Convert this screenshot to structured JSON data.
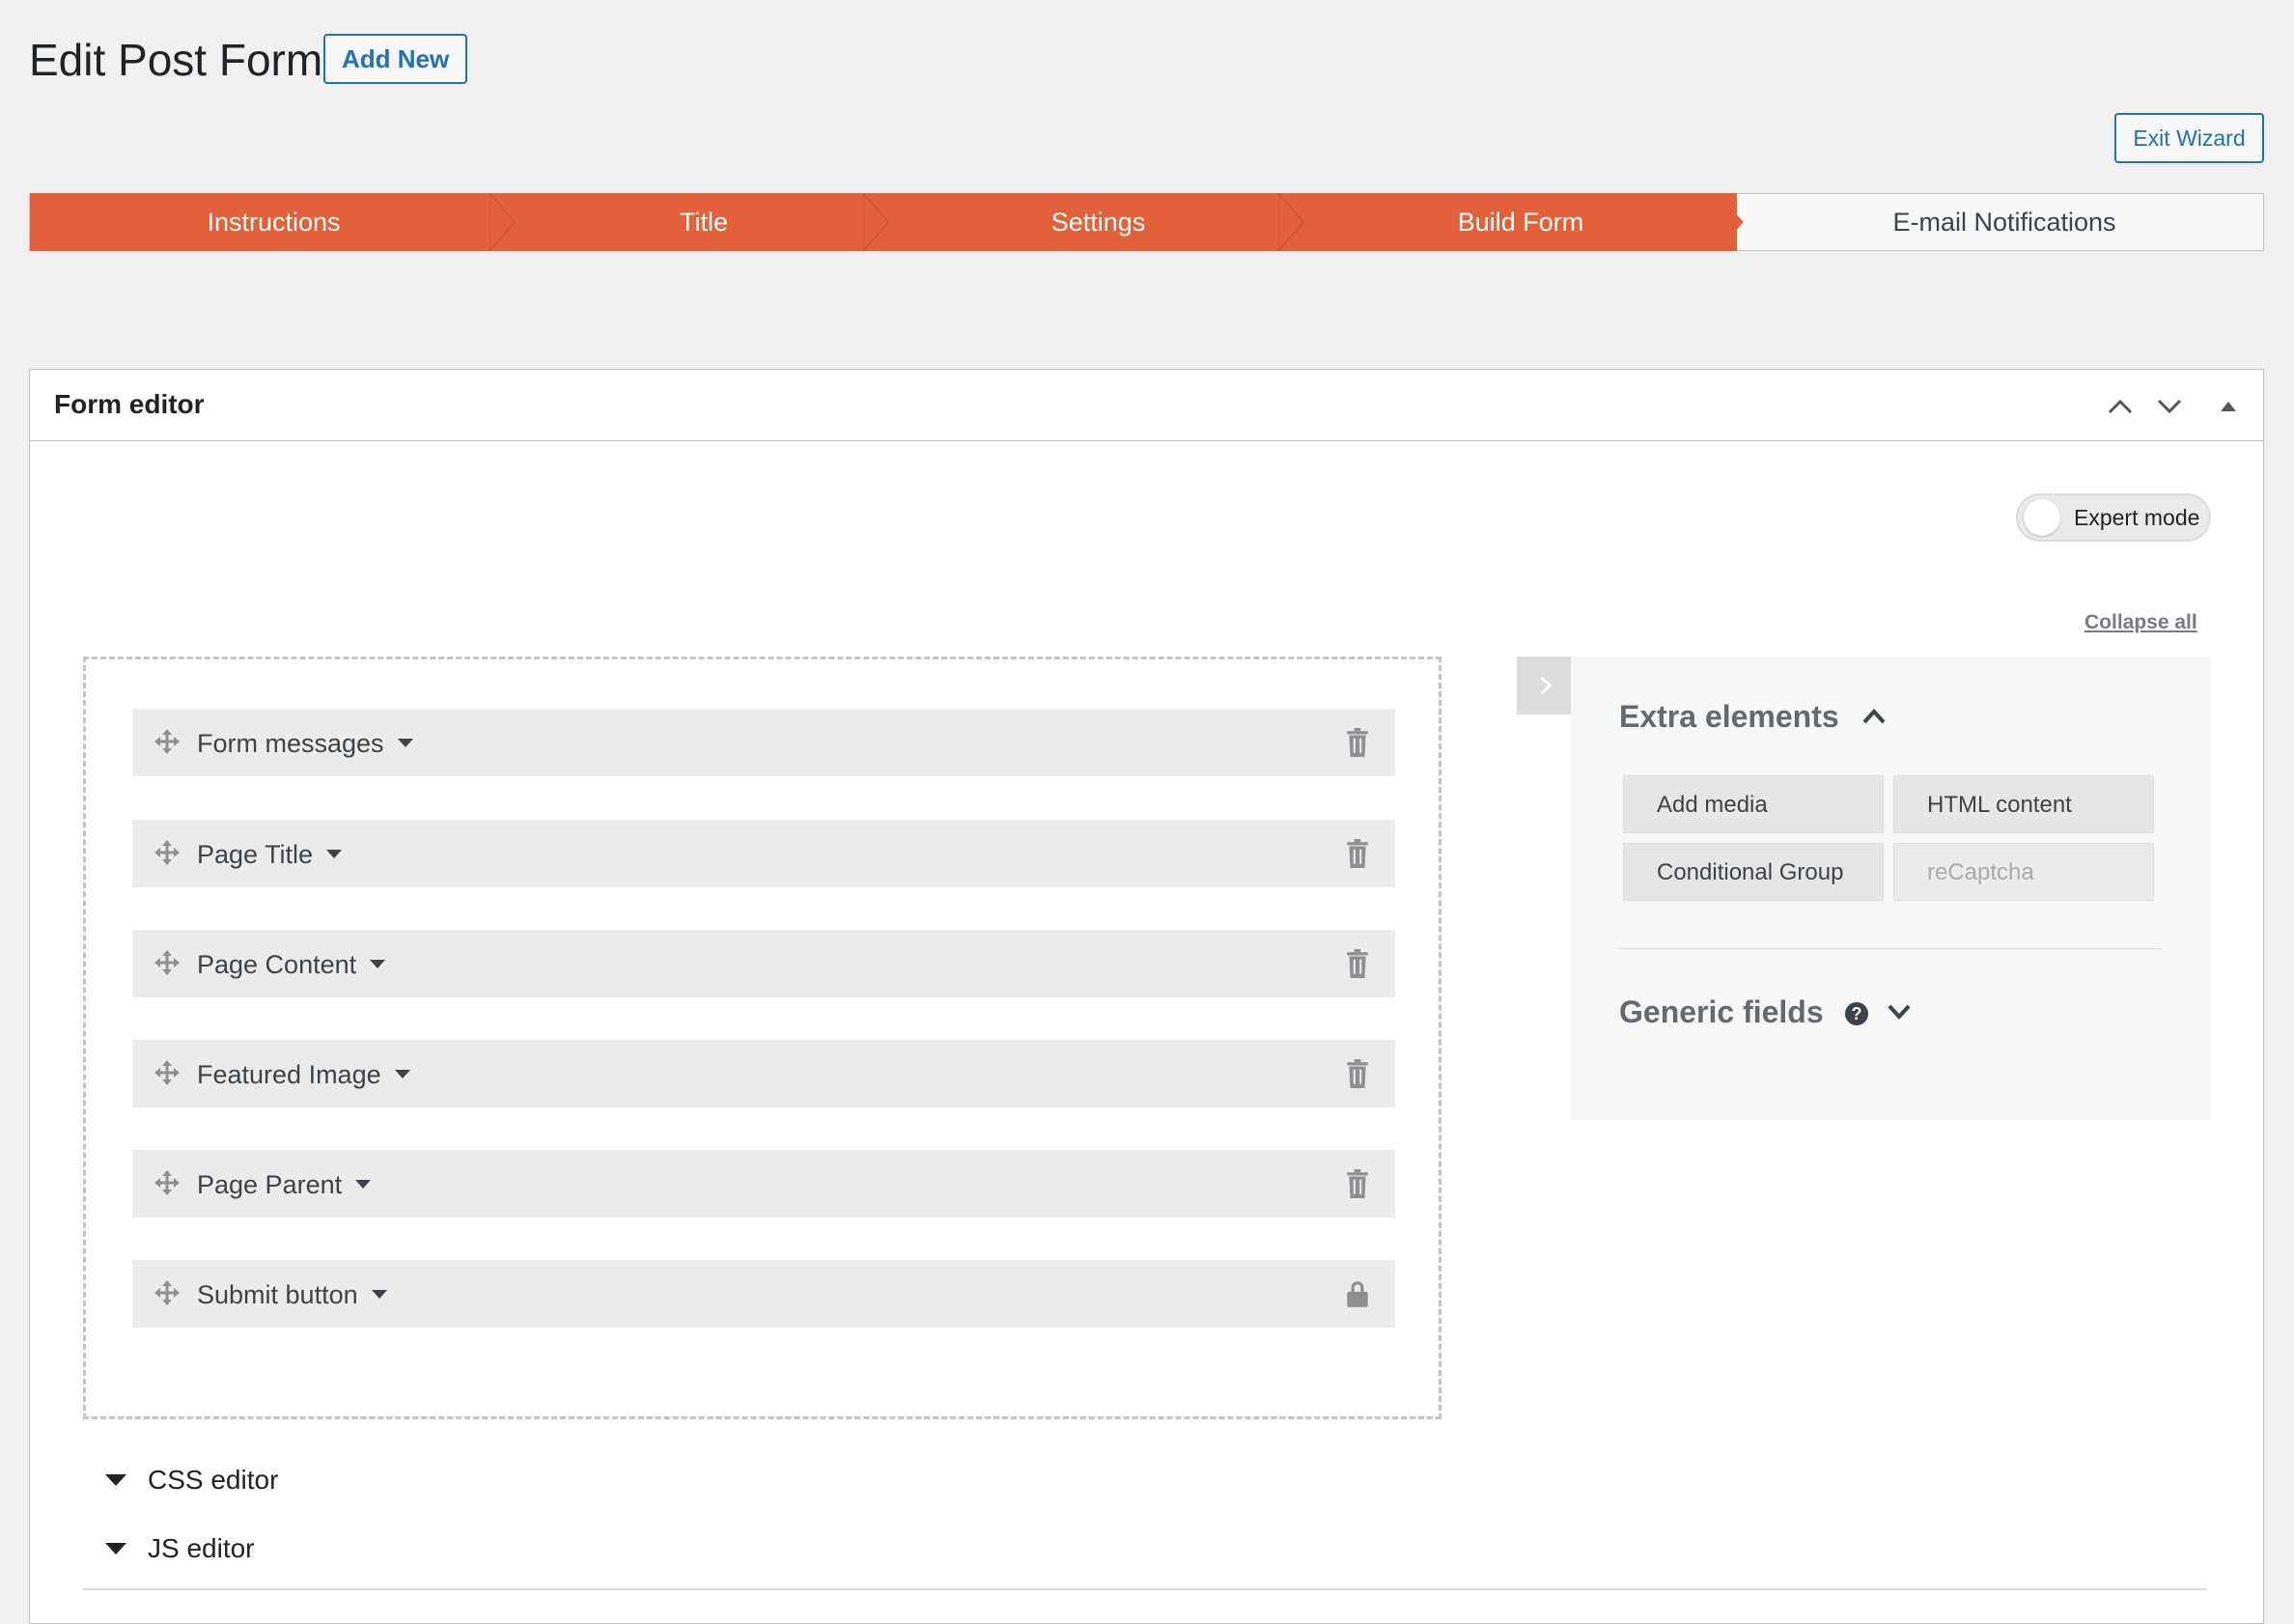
{
  "header": {
    "title": "Edit Post Form",
    "add_new_label": "Add New",
    "exit_wizard_label": "Exit Wizard"
  },
  "wizard": {
    "steps": [
      {
        "label": "Instructions",
        "state": "done"
      },
      {
        "label": "Title",
        "state": "done"
      },
      {
        "label": "Settings",
        "state": "done"
      },
      {
        "label": "Build Form",
        "state": "current"
      },
      {
        "label": "E-mail Notifications",
        "state": "todo"
      }
    ],
    "accent_color": "#e1623a"
  },
  "form_editor": {
    "title": "Form editor",
    "expert_mode_label": "Expert mode",
    "expert_mode_on": false,
    "collapse_all_label": "Collapse all",
    "fields": [
      {
        "label": "Form messages",
        "action_icon": "trash-icon"
      },
      {
        "label": "Page Title",
        "action_icon": "trash-icon"
      },
      {
        "label": "Page Content",
        "action_icon": "trash-icon"
      },
      {
        "label": "Featured Image",
        "action_icon": "trash-icon"
      },
      {
        "label": "Page Parent",
        "action_icon": "trash-icon"
      },
      {
        "label": "Submit button",
        "action_icon": "lock-icon"
      }
    ],
    "sidebar": {
      "extra_elements_heading": "Extra elements",
      "extra_elements": [
        {
          "label": "Add media",
          "disabled": false
        },
        {
          "label": "HTML content",
          "disabled": false
        },
        {
          "label": "Conditional Group",
          "disabled": false
        },
        {
          "label": "reCaptcha",
          "disabled": true
        }
      ],
      "generic_fields_heading": "Generic fields"
    },
    "css_editor_label": "CSS editor",
    "js_editor_label": "JS editor"
  }
}
